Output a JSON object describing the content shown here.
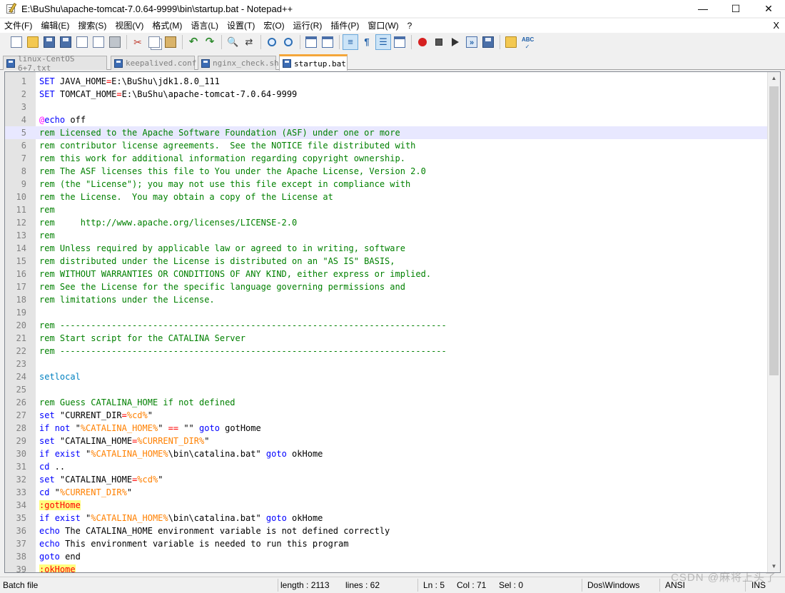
{
  "window": {
    "title": "E:\\BuShu\\apache-tomcat-7.0.64-9999\\bin\\startup.bat - Notepad++",
    "min_glyph": "—",
    "max_glyph": "☐",
    "close_glyph": "✕"
  },
  "menu": {
    "items": [
      "文件(F)",
      "编辑(E)",
      "搜索(S)",
      "视图(V)",
      "格式(M)",
      "语言(L)",
      "设置(T)",
      "宏(O)",
      "运行(R)",
      "插件(P)",
      "窗口(W)",
      "?"
    ],
    "close_label": "X"
  },
  "toolbar": {
    "icons": [
      "new-file-icon",
      "open-folder-icon",
      "save-icon",
      "save-all-icon",
      "close-icon",
      "close-all-icon",
      "print-icon",
      "cut-icon",
      "copy-icon",
      "paste-icon",
      "undo-icon",
      "redo-icon",
      "find-icon",
      "replace-icon",
      "zoom-in-icon",
      "zoom-out-icon",
      "sync-vertical-icon",
      "sync-horizontal-icon",
      "word-wrap-icon",
      "show-all-chars-icon",
      "indent-guide-icon",
      "doc-map-icon",
      "record-macro-icon",
      "stop-record-icon",
      "playback-icon",
      "run-macro-multiple-icon",
      "save-macro-icon",
      "open-file-icon",
      "spell-check-icon"
    ]
  },
  "tabs": [
    {
      "label": "linux-CentOS 6+7.txt",
      "active": false
    },
    {
      "label": "keepalived.conf",
      "active": false
    },
    {
      "label": "nginx_check.sh",
      "active": false
    },
    {
      "label": "startup.bat",
      "active": true
    }
  ],
  "editor": {
    "current_line": 5,
    "lines": [
      {
        "n": "1",
        "segs": [
          [
            "kw",
            "SET"
          ],
          [
            "plain",
            " JAVA_HOME"
          ],
          [
            "op",
            "="
          ],
          [
            "plain",
            "E:\\BuShu\\jdk1.8.0_111"
          ]
        ]
      },
      {
        "n": "2",
        "segs": [
          [
            "kw",
            "SET"
          ],
          [
            "plain",
            " TOMCAT_HOME"
          ],
          [
            "op",
            "="
          ],
          [
            "plain",
            "E:\\BuShu\\apache-tomcat-7.0.64-9999"
          ]
        ]
      },
      {
        "n": "3",
        "segs": []
      },
      {
        "n": "4",
        "segs": [
          [
            "at",
            "@"
          ],
          [
            "kw",
            "echo"
          ],
          [
            "plain",
            " off"
          ]
        ]
      },
      {
        "n": "5",
        "segs": [
          [
            "cm",
            "rem Licensed to the Apache Software Foundation (ASF) under one or more"
          ]
        ]
      },
      {
        "n": "6",
        "segs": [
          [
            "cm",
            "rem contributor license agreements.  See the NOTICE file distributed with"
          ]
        ]
      },
      {
        "n": "7",
        "segs": [
          [
            "cm",
            "rem this work for additional information regarding copyright ownership."
          ]
        ]
      },
      {
        "n": "8",
        "segs": [
          [
            "cm",
            "rem The ASF licenses this file to You under the Apache License, Version 2.0"
          ]
        ]
      },
      {
        "n": "9",
        "segs": [
          [
            "cm",
            "rem (the \"License\"); you may not use this file except in compliance with"
          ]
        ]
      },
      {
        "n": "10",
        "segs": [
          [
            "cm",
            "rem the License.  You may obtain a copy of the License at"
          ]
        ]
      },
      {
        "n": "11",
        "segs": [
          [
            "cm",
            "rem"
          ]
        ]
      },
      {
        "n": "12",
        "segs": [
          [
            "cm",
            "rem     http://www.apache.org/licenses/LICENSE-2.0"
          ]
        ]
      },
      {
        "n": "13",
        "segs": [
          [
            "cm",
            "rem"
          ]
        ]
      },
      {
        "n": "14",
        "segs": [
          [
            "cm",
            "rem Unless required by applicable law or agreed to in writing, software"
          ]
        ]
      },
      {
        "n": "15",
        "segs": [
          [
            "cm",
            "rem distributed under the License is distributed on an \"AS IS\" BASIS,"
          ]
        ]
      },
      {
        "n": "16",
        "segs": [
          [
            "cm",
            "rem WITHOUT WARRANTIES OR CONDITIONS OF ANY KIND, either express or implied."
          ]
        ]
      },
      {
        "n": "17",
        "segs": [
          [
            "cm",
            "rem See the License for the specific language governing permissions and"
          ]
        ]
      },
      {
        "n": "18",
        "segs": [
          [
            "cm",
            "rem limitations under the License."
          ]
        ]
      },
      {
        "n": "19",
        "segs": []
      },
      {
        "n": "20",
        "segs": [
          [
            "cm",
            "rem ---------------------------------------------------------------------------"
          ]
        ]
      },
      {
        "n": "21",
        "segs": [
          [
            "cm",
            "rem Start script for the CATALINA Server"
          ]
        ]
      },
      {
        "n": "22",
        "segs": [
          [
            "cm",
            "rem ---------------------------------------------------------------------------"
          ]
        ]
      },
      {
        "n": "23",
        "segs": []
      },
      {
        "n": "24",
        "segs": [
          [
            "setlocal",
            "setlocal"
          ]
        ]
      },
      {
        "n": "25",
        "segs": []
      },
      {
        "n": "26",
        "segs": [
          [
            "cm",
            "rem Guess CATALINA_HOME if not defined"
          ]
        ]
      },
      {
        "n": "27",
        "segs": [
          [
            "kw",
            "set"
          ],
          [
            "plain",
            " \"CURRENT_DIR"
          ],
          [
            "op",
            "="
          ],
          [
            "var",
            "%cd%"
          ],
          [
            "plain",
            "\""
          ]
        ]
      },
      {
        "n": "28",
        "segs": [
          [
            "kw",
            "if"
          ],
          [
            "plain",
            " "
          ],
          [
            "kw",
            "not"
          ],
          [
            "plain",
            " \""
          ],
          [
            "var",
            "%CATALINA_HOME%"
          ],
          [
            "plain",
            "\" "
          ],
          [
            "op",
            "=="
          ],
          [
            "plain",
            " \"\" "
          ],
          [
            "kw",
            "goto"
          ],
          [
            "plain",
            " gotHome"
          ]
        ]
      },
      {
        "n": "29",
        "segs": [
          [
            "kw",
            "set"
          ],
          [
            "plain",
            " \"CATALINA_HOME"
          ],
          [
            "op",
            "="
          ],
          [
            "var",
            "%CURRENT_DIR%"
          ],
          [
            "plain",
            "\""
          ]
        ]
      },
      {
        "n": "30",
        "segs": [
          [
            "kw",
            "if"
          ],
          [
            "plain",
            " "
          ],
          [
            "kw",
            "exist"
          ],
          [
            "plain",
            " \""
          ],
          [
            "var",
            "%CATALINA_HOME%"
          ],
          [
            "plain",
            "\\bin\\catalina.bat\" "
          ],
          [
            "kw",
            "goto"
          ],
          [
            "plain",
            " okHome"
          ]
        ]
      },
      {
        "n": "31",
        "segs": [
          [
            "kw",
            "cd"
          ],
          [
            "plain",
            " .."
          ]
        ]
      },
      {
        "n": "32",
        "segs": [
          [
            "kw",
            "set"
          ],
          [
            "plain",
            " \"CATALINA_HOME"
          ],
          [
            "op",
            "="
          ],
          [
            "var",
            "%cd%"
          ],
          [
            "plain",
            "\""
          ]
        ]
      },
      {
        "n": "33",
        "segs": [
          [
            "kw",
            "cd"
          ],
          [
            "plain",
            " \""
          ],
          [
            "var",
            "%CURRENT_DIR%"
          ],
          [
            "plain",
            "\""
          ]
        ]
      },
      {
        "n": "34",
        "segs": [
          [
            "lbl",
            ":gotHome"
          ]
        ]
      },
      {
        "n": "35",
        "segs": [
          [
            "kw",
            "if"
          ],
          [
            "plain",
            " "
          ],
          [
            "kw",
            "exist"
          ],
          [
            "plain",
            " \""
          ],
          [
            "var",
            "%CATALINA_HOME%"
          ],
          [
            "plain",
            "\\bin\\catalina.bat\" "
          ],
          [
            "kw",
            "goto"
          ],
          [
            "plain",
            " okHome"
          ]
        ]
      },
      {
        "n": "36",
        "segs": [
          [
            "kw",
            "echo"
          ],
          [
            "plain",
            " The CATALINA_HOME environment variable is not defined correctly"
          ]
        ]
      },
      {
        "n": "37",
        "segs": [
          [
            "kw",
            "echo"
          ],
          [
            "plain",
            " This environment variable is needed to run this program"
          ]
        ]
      },
      {
        "n": "38",
        "segs": [
          [
            "kw",
            "goto"
          ],
          [
            "plain",
            " end"
          ]
        ]
      },
      {
        "n": "39",
        "segs": [
          [
            "lbl",
            ":okHome"
          ]
        ]
      }
    ]
  },
  "status": {
    "file_type": "Batch file",
    "length": "length : 2113",
    "lines": "lines : 62",
    "ln": "Ln : 5",
    "col": "Col : 71",
    "sel": "Sel : 0",
    "eol": "Dos\\Windows",
    "encoding": "ANSI",
    "mode": "INS"
  },
  "watermark": "CSDN @麻将上头了"
}
